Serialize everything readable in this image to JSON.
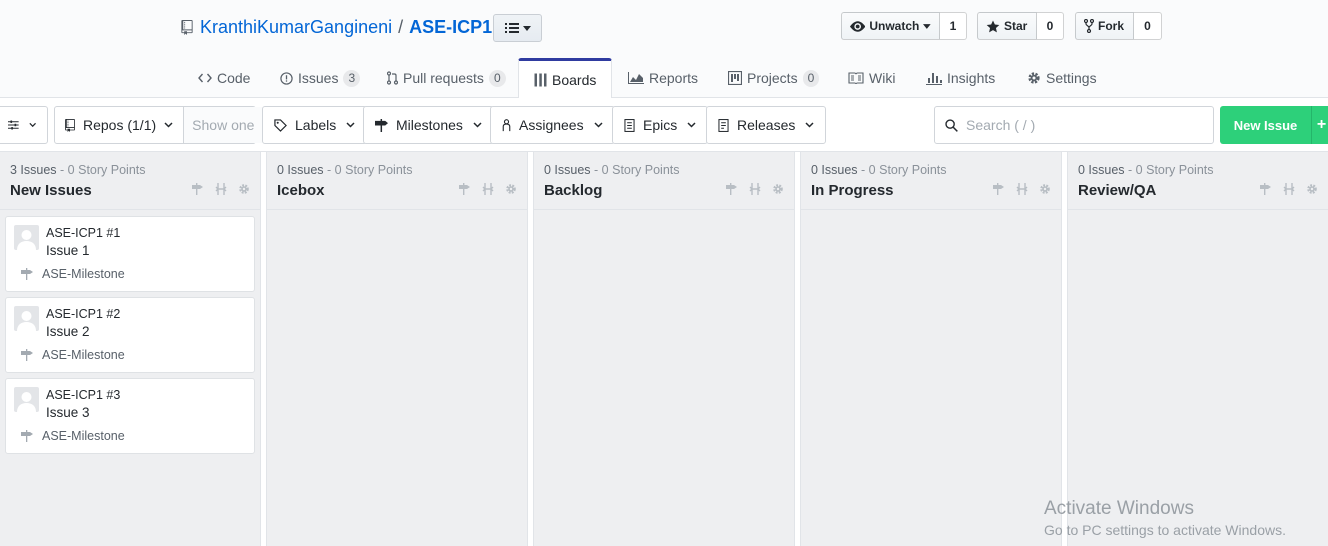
{
  "repo": {
    "owner": "KranthiKumarGangineni",
    "separator": "/",
    "name": "ASE-ICP1"
  },
  "actions": {
    "watch_label": "Unwatch",
    "watch_count": "1",
    "star_label": "Star",
    "star_count": "0",
    "fork_label": "Fork",
    "fork_count": "0"
  },
  "tabs": {
    "code": {
      "label": "Code"
    },
    "issues": {
      "label": "Issues",
      "count": "3"
    },
    "pulls": {
      "label": "Pull requests",
      "count": "0"
    },
    "boards": {
      "label": "Boards"
    },
    "reports": {
      "label": "Reports"
    },
    "projects": {
      "label": "Projects",
      "count": "0"
    },
    "wiki": {
      "label": "Wiki"
    },
    "insights": {
      "label": "Insights"
    },
    "settings": {
      "label": "Settings"
    }
  },
  "toolbar": {
    "repos_label": "Repos (1/1)",
    "show_one": "Show one",
    "labels": "Labels",
    "milestones": "Milestones",
    "assignees": "Assignees",
    "epics": "Epics",
    "releases": "Releases",
    "search_placeholder": "Search ( / )",
    "new_issue": "New Issue",
    "new_issue_plus": "+"
  },
  "pipelines": [
    {
      "meta": "3 Issues",
      "points": "- 0 Story Points",
      "name": "New Issues",
      "cards": [
        {
          "ref": "ASE-ICP1 #1",
          "title": "Issue 1",
          "milestone": "ASE-Milestone"
        },
        {
          "ref": "ASE-ICP1 #2",
          "title": "Issue 2",
          "milestone": "ASE-Milestone"
        },
        {
          "ref": "ASE-ICP1 #3",
          "title": "Issue 3",
          "milestone": "ASE-Milestone"
        }
      ]
    },
    {
      "meta": "0 Issues",
      "points": "- 0 Story Points",
      "name": "Icebox",
      "cards": []
    },
    {
      "meta": "0 Issues",
      "points": "- 0 Story Points",
      "name": "Backlog",
      "cards": []
    },
    {
      "meta": "0 Issues",
      "points": "- 0 Story Points",
      "name": "In Progress",
      "cards": []
    },
    {
      "meta": "0 Issues",
      "points": "- 0 Story Points",
      "name": "Review/QA",
      "cards": []
    }
  ],
  "watermark": {
    "line1": "Activate Windows",
    "line2": "Go to PC settings to activate Windows."
  },
  "colors": {
    "accent_tab": "#2f3ba0",
    "link": "#0366d6",
    "new_issue": "#2dd07a",
    "pipeline_bg": "#eeeff1"
  }
}
